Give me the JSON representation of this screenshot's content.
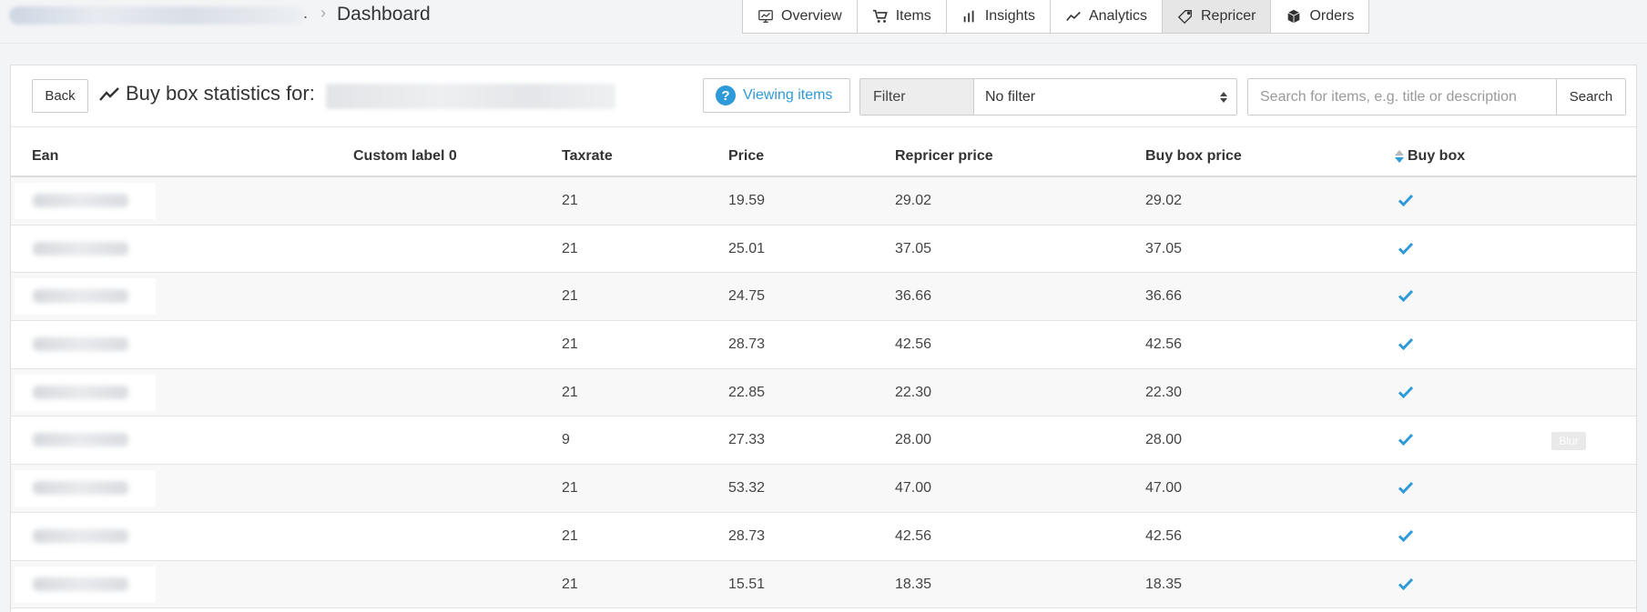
{
  "header": {
    "breadcrumb_separator": ".",
    "page_title": "Dashboard"
  },
  "nav": {
    "tabs": [
      {
        "label": "Overview",
        "icon": "presentation-chart-icon",
        "active": false
      },
      {
        "label": "Items",
        "icon": "cart-icon",
        "active": false
      },
      {
        "label": "Insights",
        "icon": "bar-chart-icon",
        "active": false
      },
      {
        "label": "Analytics",
        "icon": "line-chart-icon",
        "active": false
      },
      {
        "label": "Repricer",
        "icon": "tag-icon",
        "active": true
      },
      {
        "label": "Orders",
        "icon": "box-icon",
        "active": false
      }
    ]
  },
  "toolbar": {
    "back_label": "Back",
    "title": "Buy box statistics for:",
    "viewing_items_label": "Viewing items",
    "filter_label": "Filter",
    "filter_value": "No filter",
    "search_placeholder": "Search for items, e.g. title or description",
    "search_button": "Search"
  },
  "table": {
    "columns": {
      "ean": "Ean",
      "custom_label": "Custom label 0",
      "taxrate": "Taxrate",
      "price": "Price",
      "repricer_price": "Repricer price",
      "buy_box_price": "Buy box price",
      "buy_box": "Buy box"
    },
    "rows": [
      {
        "taxrate": "21",
        "price": "19.59",
        "repricer_price": "29.02",
        "buy_box_price": "29.02",
        "buy_box": true
      },
      {
        "taxrate": "21",
        "price": "25.01",
        "repricer_price": "37.05",
        "buy_box_price": "37.05",
        "buy_box": true
      },
      {
        "taxrate": "21",
        "price": "24.75",
        "repricer_price": "36.66",
        "buy_box_price": "36.66",
        "buy_box": true
      },
      {
        "taxrate": "21",
        "price": "28.73",
        "repricer_price": "42.56",
        "buy_box_price": "42.56",
        "buy_box": true
      },
      {
        "taxrate": "21",
        "price": "22.85",
        "repricer_price": "22.30",
        "buy_box_price": "22.30",
        "buy_box": true
      },
      {
        "taxrate": "9",
        "price": "27.33",
        "repricer_price": "28.00",
        "buy_box_price": "28.00",
        "buy_box": true,
        "badge": "Blur"
      },
      {
        "taxrate": "21",
        "price": "53.32",
        "repricer_price": "47.00",
        "buy_box_price": "47.00",
        "buy_box": true
      },
      {
        "taxrate": "21",
        "price": "28.73",
        "repricer_price": "42.56",
        "buy_box_price": "42.56",
        "buy_box": true
      },
      {
        "taxrate": "21",
        "price": "15.51",
        "repricer_price": "18.35",
        "buy_box_price": "18.35",
        "buy_box": true
      }
    ]
  },
  "colors": {
    "accent": "#2e9ad8",
    "check": "#2e9ad8",
    "active_tab_bg": "#e6e6e6"
  }
}
